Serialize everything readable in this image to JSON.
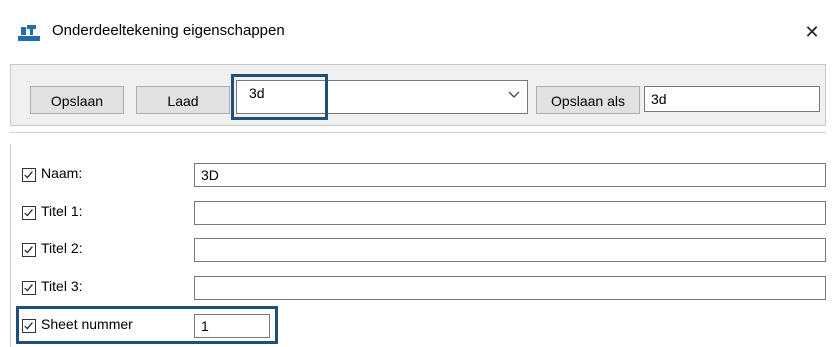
{
  "window": {
    "title": "Onderdeeltekening eigenschappen",
    "close_glyph": "✕",
    "app_icon": "drawing-properties-icon"
  },
  "toolbar": {
    "save_label": "Opslaan",
    "load_label": "Laad",
    "settings_combo_value": "3d",
    "save_as_label": "Opslaan als",
    "save_as_value": "3d"
  },
  "properties": [
    {
      "label": "Naam:",
      "checked": true,
      "value": "3D"
    },
    {
      "label": "Titel 1:",
      "checked": true,
      "value": ""
    },
    {
      "label": "Titel 2:",
      "checked": true,
      "value": ""
    },
    {
      "label": "Titel 3:",
      "checked": true,
      "value": ""
    },
    {
      "label": "Sheet nummer",
      "checked": true,
      "value": "1"
    }
  ],
  "colors": {
    "highlight": "#1f4e79",
    "panel_bg": "#f0f0f0",
    "button_bg": "#e1e1e1"
  }
}
